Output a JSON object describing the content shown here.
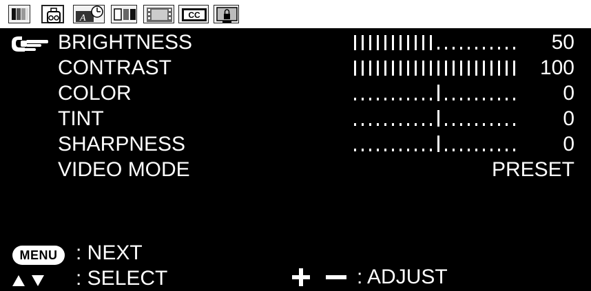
{
  "tabs": [
    {
      "name": "picture-tab-icon",
      "active": false
    },
    {
      "name": "audio-tab-icon",
      "active": true
    },
    {
      "name": "timer-tab-icon",
      "active": false
    },
    {
      "name": "screen-tab-icon",
      "active": false
    },
    {
      "name": "setup-tab-icon",
      "active": false
    },
    {
      "name": "cc-tab-icon",
      "active": false,
      "label": "CC"
    },
    {
      "name": "lock-tab-icon",
      "active": false
    }
  ],
  "menu": {
    "items": [
      {
        "label": "BRIGHTNESS",
        "type": "bar",
        "level": 50,
        "value": "50",
        "selected": true
      },
      {
        "label": "CONTRAST",
        "type": "bar",
        "level": 100,
        "value": "100",
        "selected": false
      },
      {
        "label": "COLOR",
        "type": "center",
        "level": 0,
        "value": "0",
        "selected": false
      },
      {
        "label": "TINT",
        "type": "center",
        "level": 0,
        "value": "0",
        "selected": false
      },
      {
        "label": "SHARPNESS",
        "type": "center",
        "level": 0,
        "value": "0",
        "selected": false
      },
      {
        "label": "VIDEO MODE",
        "type": "text",
        "value": "PRESET",
        "selected": false
      }
    ]
  },
  "footer": {
    "menu_key": "MENU",
    "next": ": NEXT",
    "select": ": SELECT",
    "adjust": ": ADJUST"
  },
  "colors": {
    "background": "#000000",
    "text": "#ffffff",
    "tabstrip": "#ffffff"
  }
}
